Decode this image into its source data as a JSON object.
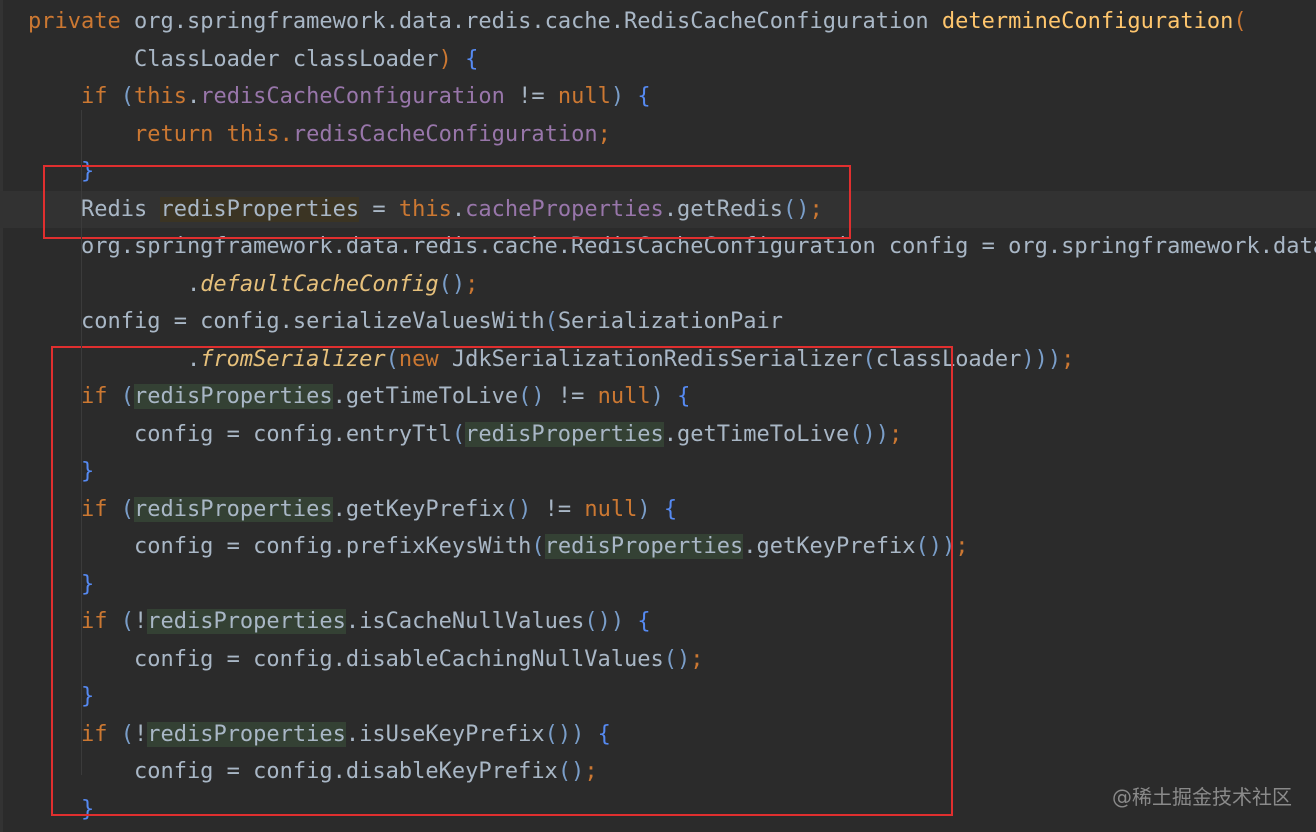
{
  "lines": [
    {
      "id": "l0",
      "segments": [
        [
          "kw",
          "private "
        ],
        [
          "",
          "org.springframework.data.redis.cache.RedisCacheConfiguration "
        ],
        [
          "method-st",
          "determineConfiguration"
        ],
        [
          "kw",
          "("
        ]
      ]
    },
    {
      "id": "l1",
      "segments": [
        [
          "",
          "        ClassLoader classLoader"
        ],
        [
          "kw",
          ") "
        ],
        [
          "brace",
          "{"
        ]
      ]
    },
    {
      "id": "l2",
      "segments": [
        [
          "kw",
          "    if "
        ],
        [
          "paren",
          "("
        ],
        [
          "kw",
          "this"
        ],
        [
          "",
          "."
        ],
        [
          "field",
          "redisCacheConfiguration"
        ],
        [
          "",
          " != "
        ],
        [
          "kw",
          "null"
        ],
        [
          "paren",
          ") "
        ],
        [
          "brace",
          "{"
        ]
      ]
    },
    {
      "id": "l3",
      "segments": [
        [
          "kw",
          "        return this"
        ],
        [
          "kw",
          "."
        ],
        [
          "field",
          "redisCacheConfiguration"
        ],
        [
          "kw",
          ";"
        ]
      ]
    },
    {
      "id": "l4",
      "segments": [
        [
          "brace",
          "    }"
        ]
      ]
    },
    {
      "id": "l5",
      "segments": [
        [
          "",
          "    Redis "
        ],
        [
          "hl-y",
          "redisProperties"
        ],
        [
          "",
          " = "
        ],
        [
          "kw",
          "this"
        ],
        [
          "",
          "."
        ],
        [
          "field",
          "cacheProperties"
        ],
        [
          "",
          ".getRedis"
        ],
        [
          "paren",
          "()"
        ],
        [
          "kw",
          ";"
        ]
      ]
    },
    {
      "id": "l6",
      "segments": [
        [
          "",
          "    org.springframework.data.redis.cache.RedisCacheConfiguration config = org.springframework.data.redis"
        ]
      ]
    },
    {
      "id": "l7",
      "segments": [
        [
          "",
          "            ."
        ],
        [
          "method-it",
          "defaultCacheConfig"
        ],
        [
          "paren",
          "()"
        ],
        [
          "kw",
          ";"
        ]
      ]
    },
    {
      "id": "l8",
      "segments": [
        [
          "",
          "    config = config.serializeValuesWith"
        ],
        [
          "paren",
          "("
        ],
        [
          "",
          "SerializationPair"
        ]
      ]
    },
    {
      "id": "l9",
      "segments": [
        [
          "",
          "            ."
        ],
        [
          "method-it",
          "fromSerializer"
        ],
        [
          "paren",
          "("
        ],
        [
          "kw",
          "new "
        ],
        [
          "",
          "JdkSerializationRedisSerializer"
        ],
        [
          "paren",
          "("
        ],
        [
          "",
          "classLoader"
        ],
        [
          "paren",
          ")))"
        ],
        [
          "kw",
          ";"
        ]
      ]
    },
    {
      "id": "l10",
      "segments": [
        [
          "kw",
          "    if "
        ],
        [
          "paren",
          "("
        ],
        [
          "hl",
          "redisProperties"
        ],
        [
          "",
          ".getTimeToLive"
        ],
        [
          "paren",
          "()"
        ],
        [
          "",
          " != "
        ],
        [
          "kw",
          "null"
        ],
        [
          "paren",
          ") "
        ],
        [
          "brace",
          "{"
        ]
      ]
    },
    {
      "id": "l11",
      "segments": [
        [
          "",
          "        config = config.entryTtl"
        ],
        [
          "paren",
          "("
        ],
        [
          "hl",
          "redisProperties"
        ],
        [
          "",
          ".getTimeToLive"
        ],
        [
          "paren",
          "())"
        ],
        [
          "kw",
          ";"
        ]
      ]
    },
    {
      "id": "l12",
      "segments": [
        [
          "brace",
          "    }"
        ]
      ]
    },
    {
      "id": "l13",
      "segments": [
        [
          "kw",
          "    if "
        ],
        [
          "paren",
          "("
        ],
        [
          "hl",
          "redisProperties"
        ],
        [
          "",
          ".getKeyPrefix"
        ],
        [
          "paren",
          "()"
        ],
        [
          "",
          " != "
        ],
        [
          "kw",
          "null"
        ],
        [
          "paren",
          ") "
        ],
        [
          "brace",
          "{"
        ]
      ]
    },
    {
      "id": "l14",
      "segments": [
        [
          "",
          "        config = config.prefixKeysWith"
        ],
        [
          "paren",
          "("
        ],
        [
          "hl",
          "redisProperties"
        ],
        [
          "",
          ".getKeyPrefix"
        ],
        [
          "paren",
          "())"
        ],
        [
          "kw",
          ";"
        ]
      ]
    },
    {
      "id": "l15",
      "segments": [
        [
          "brace",
          "    }"
        ]
      ]
    },
    {
      "id": "l16",
      "segments": [
        [
          "kw",
          "    if "
        ],
        [
          "paren",
          "("
        ],
        [
          "",
          "!"
        ],
        [
          "hl",
          "redisProperties"
        ],
        [
          "",
          ".isCacheNullValues"
        ],
        [
          "paren",
          "()) "
        ],
        [
          "brace",
          "{"
        ]
      ]
    },
    {
      "id": "l17",
      "segments": [
        [
          "",
          "        config = config.disableCachingNullValues"
        ],
        [
          "paren",
          "()"
        ],
        [
          "kw",
          ";"
        ]
      ]
    },
    {
      "id": "l18",
      "segments": [
        [
          "brace",
          "    }"
        ]
      ]
    },
    {
      "id": "l19",
      "segments": [
        [
          "kw",
          "    if "
        ],
        [
          "paren",
          "("
        ],
        [
          "",
          "!"
        ],
        [
          "hl",
          "redisProperties"
        ],
        [
          "",
          ".isUseKeyPrefix"
        ],
        [
          "paren",
          "()) "
        ],
        [
          "brace",
          "{"
        ]
      ]
    },
    {
      "id": "l20",
      "segments": [
        [
          "",
          "        config = config.disableKeyPrefix"
        ],
        [
          "paren",
          "()"
        ],
        [
          "kw",
          ";"
        ]
      ]
    },
    {
      "id": "l21",
      "segments": [
        [
          "brace",
          "    }"
        ]
      ]
    }
  ],
  "watermark": "@稀土掘金技术社区",
  "colors": {
    "background": "#2b2b2b",
    "annotation_box": "#e02f2f",
    "keyword": "#cc7832",
    "field": "#9876aa"
  }
}
